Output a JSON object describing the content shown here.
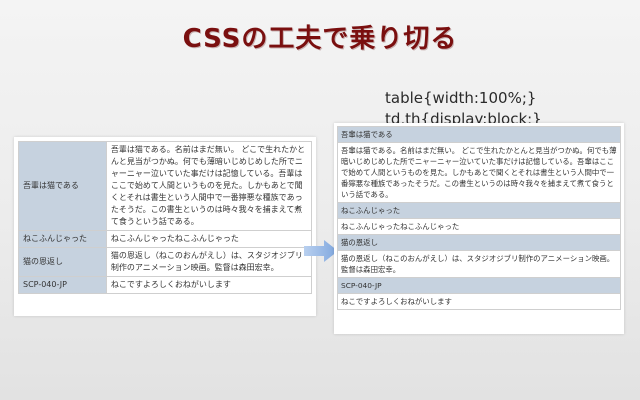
{
  "slide": {
    "title": "CSSの工夫で乗り切る",
    "code": [
      "table{width:100%;}",
      "td,th{display:block;}"
    ]
  },
  "table": {
    "rows": [
      {
        "header": "吾輩は猫である",
        "body": "吾輩は猫である。名前はまだ無い。 どこで生れたかとんと見当がつかぬ。何でも薄暗いじめじめした所でニャーニャー泣いていた事だけは記憶している。吾輩はここで始めて人間というものを見た。しかもあとで聞くとそれは書生という人間中で一番獰悪な種族であったそうだ。この書生というのは時々我々を捕まえて煮て食うという話である。"
      },
      {
        "header": "ねこふんじゃった",
        "body": "ねこふんじゃったねこふんじゃった"
      },
      {
        "header": "猫の恩返し",
        "body": "猫の恩返し（ねこのおんがえし）は、スタジオジブリ制作のアニメーション映画。監督は森田宏幸。"
      },
      {
        "header": "SCP-040-JP",
        "body": "ねこですよろしくおねがいします"
      }
    ]
  },
  "colors": {
    "title": "#7a0f0f",
    "header_bg": "#c6d2df",
    "arrow": "#8fb3e3"
  },
  "icons": {
    "arrow": "right-arrow-icon"
  }
}
